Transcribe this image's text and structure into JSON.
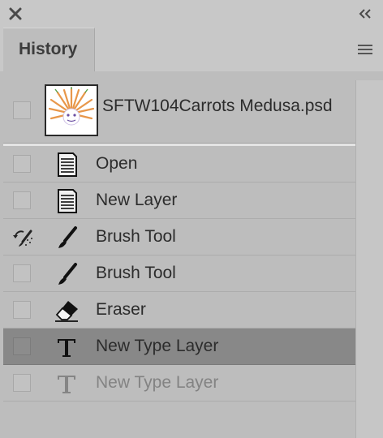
{
  "window": {
    "close_icon": "close-icon",
    "collapse_icon": "double-chevron-left-icon"
  },
  "tabs": [
    {
      "label": "History",
      "active": true
    }
  ],
  "panel_menu_icon": "hamburger-menu-icon",
  "snapshot": {
    "label": "SFTW104Carrots Medusa.psd",
    "thumbnail": "document-thumbnail"
  },
  "history_states": [
    {
      "label": "Open",
      "icon": "document-icon",
      "state": "normal"
    },
    {
      "label": "New Layer",
      "icon": "document-icon",
      "state": "normal"
    },
    {
      "label": "Brush Tool",
      "icon": "brush-icon",
      "state": "normal",
      "history_brush_source": true
    },
    {
      "label": "Brush Tool",
      "icon": "brush-icon",
      "state": "normal"
    },
    {
      "label": "Eraser",
      "icon": "eraser-icon",
      "state": "normal"
    },
    {
      "label": "New Type Layer",
      "icon": "type-icon",
      "state": "selected"
    },
    {
      "label": "New Type Layer",
      "icon": "type-icon",
      "state": "undone"
    }
  ],
  "colors": {
    "panel_bg": "#bdbdbd",
    "selected_row": "#888888",
    "undone_text": "#838383"
  }
}
